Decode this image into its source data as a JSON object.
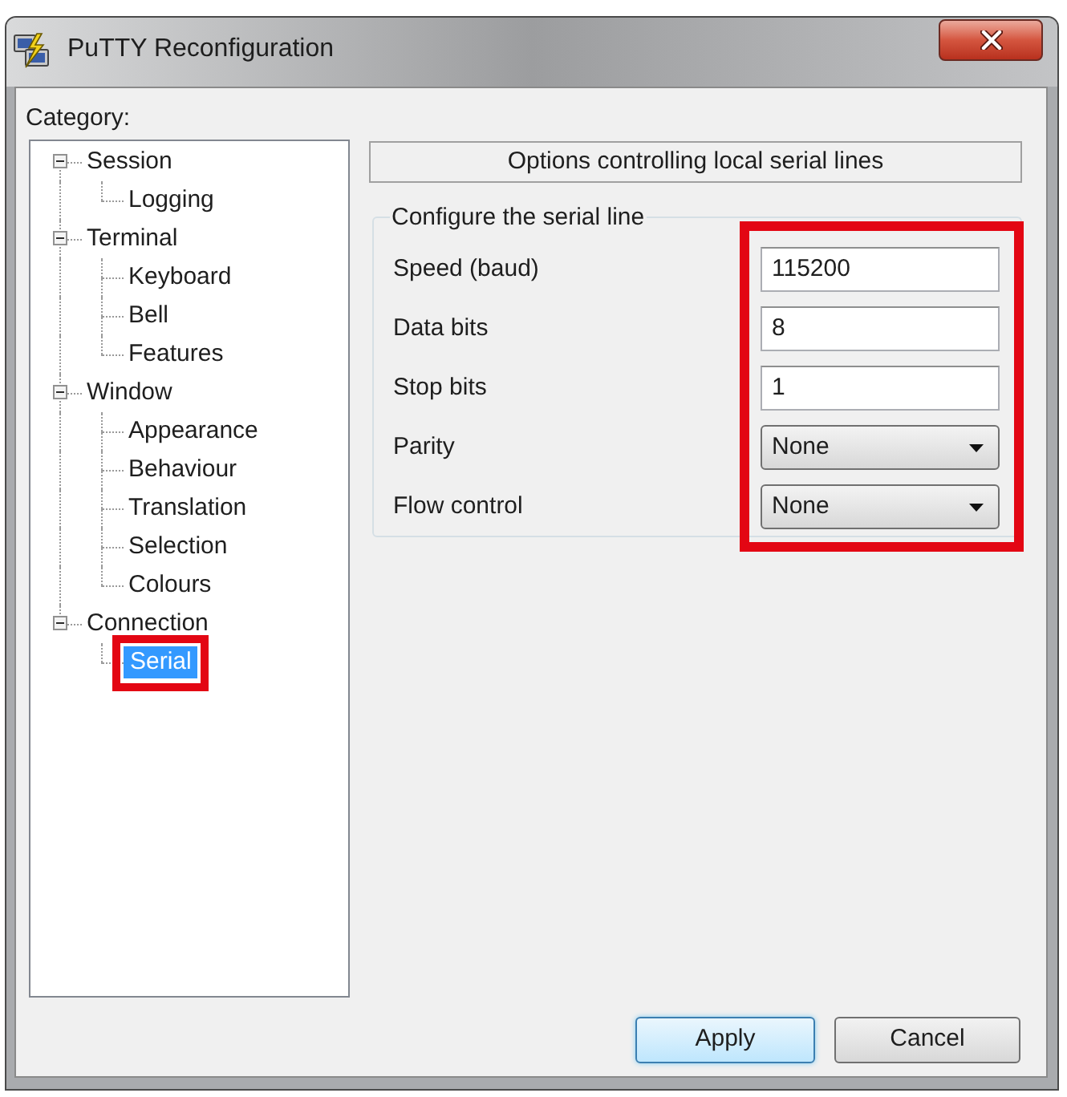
{
  "window": {
    "title": "PuTTY Reconfiguration"
  },
  "category": {
    "label": "Category:",
    "tree": [
      {
        "label": "Session",
        "expanded": true,
        "selected": false,
        "highlighted": false,
        "children": [
          {
            "label": "Logging",
            "selected": false,
            "highlighted": false
          }
        ]
      },
      {
        "label": "Terminal",
        "expanded": true,
        "selected": false,
        "highlighted": false,
        "children": [
          {
            "label": "Keyboard",
            "selected": false,
            "highlighted": false
          },
          {
            "label": "Bell",
            "selected": false,
            "highlighted": false
          },
          {
            "label": "Features",
            "selected": false,
            "highlighted": false
          }
        ]
      },
      {
        "label": "Window",
        "expanded": true,
        "selected": false,
        "highlighted": false,
        "children": [
          {
            "label": "Appearance",
            "selected": false,
            "highlighted": false
          },
          {
            "label": "Behaviour",
            "selected": false,
            "highlighted": false
          },
          {
            "label": "Translation",
            "selected": false,
            "highlighted": false
          },
          {
            "label": "Selection",
            "selected": false,
            "highlighted": false
          },
          {
            "label": "Colours",
            "selected": false,
            "highlighted": false
          }
        ]
      },
      {
        "label": "Connection",
        "expanded": true,
        "selected": false,
        "highlighted": false,
        "children": [
          {
            "label": "Serial",
            "selected": true,
            "highlighted": true
          }
        ]
      }
    ]
  },
  "panel": {
    "header": "Options controlling local serial lines",
    "group": {
      "title": "Configure the serial line",
      "highlighted": true,
      "fields": [
        {
          "kind": "text",
          "label": "Speed (baud)",
          "value": "115200"
        },
        {
          "kind": "text",
          "label": "Data bits",
          "value": "8"
        },
        {
          "kind": "text",
          "label": "Stop bits",
          "value": "1"
        },
        {
          "kind": "dropdown",
          "label": "Parity",
          "value": "None"
        },
        {
          "kind": "dropdown",
          "label": "Flow control",
          "value": "None"
        }
      ]
    }
  },
  "buttons": [
    {
      "label": "Apply",
      "default": true
    },
    {
      "label": "Cancel",
      "default": false
    }
  ]
}
